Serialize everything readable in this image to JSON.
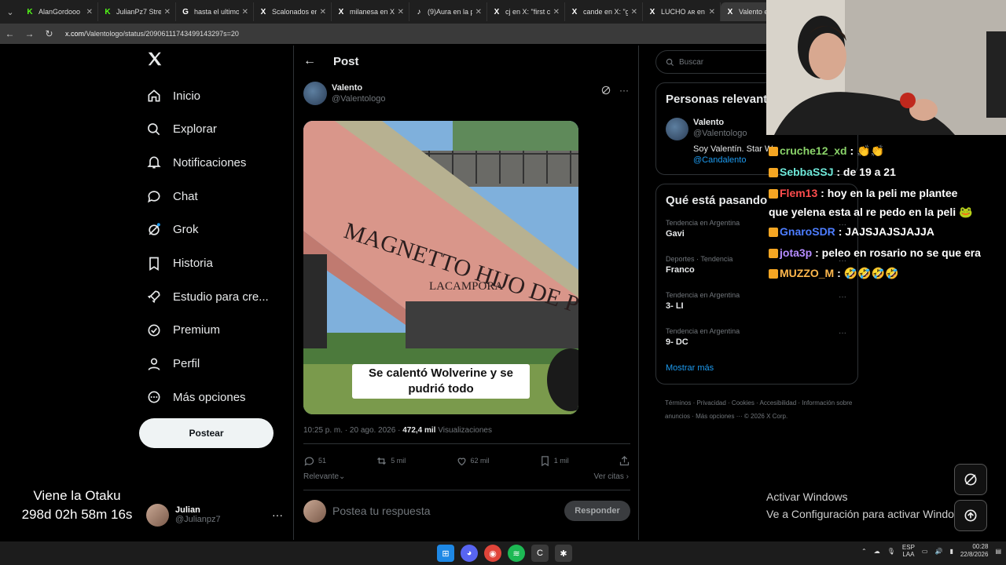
{
  "browser": {
    "tabs": [
      {
        "title": "AlanGordooo",
        "fav": "K",
        "color": "#53fc18"
      },
      {
        "title": "JulianPz7 Stre",
        "fav": "K",
        "color": "#53fc18"
      },
      {
        "title": "hasta el ultimo",
        "fav": "G",
        "color": "#ffffff"
      },
      {
        "title": "Scalonados en",
        "fav": "X",
        "color": "#ffffff"
      },
      {
        "title": "milanesa en X:",
        "fav": "X",
        "color": "#ffffff"
      },
      {
        "title": "(9)Aura en la p",
        "fav": "♪",
        "color": "#ffffff"
      },
      {
        "title": "cj en X: \"first c",
        "fav": "X",
        "color": "#ffffff"
      },
      {
        "title": "cande en X: \"g",
        "fav": "X",
        "color": "#ffffff"
      },
      {
        "title": "LUCHO ᴀʀ en",
        "fav": "X",
        "color": "#ffffff"
      },
      {
        "title": "Valento en",
        "fav": "X",
        "color": "#ffffff"
      }
    ],
    "url_host": "x.com",
    "url_path": "/Valentologo/status/20906111743499143297s=20"
  },
  "nav": {
    "items": [
      {
        "label": "Inicio",
        "icon": "home-icon"
      },
      {
        "label": "Explorar",
        "icon": "search-icon"
      },
      {
        "label": "Notificaciones",
        "icon": "bell-icon"
      },
      {
        "label": "Chat",
        "icon": "chat-icon"
      },
      {
        "label": "Grok",
        "icon": "grok-icon"
      },
      {
        "label": "Historia",
        "icon": "bookmark-icon"
      },
      {
        "label": "Estudio para cre...",
        "icon": "rocket-icon"
      },
      {
        "label": "Premium",
        "icon": "verified-icon"
      },
      {
        "label": "Perfil",
        "icon": "person-icon"
      },
      {
        "label": "Más opciones",
        "icon": "more-circle-icon"
      }
    ],
    "post_button": "Postear",
    "account": {
      "name": "Julian",
      "handle": "@Julianpz7"
    }
  },
  "overlay_timer": {
    "line1": "Viene la Otaku",
    "line2": "298d 02h 58m 16s"
  },
  "post": {
    "header": "Post",
    "author_name": "Valento",
    "author_handle": "@Valentologo",
    "image_graffiti": "MAGNETTO HIJO DE PUTA",
    "image_graffiti_sub": "LACAMPORA",
    "caption": "Se calentó Wolverine y se pudrió todo",
    "timestamp": "10:25 p. m. · 20 ago. 2026 · ",
    "views_count": "472,4 mil",
    "views_label": " Visualizaciones",
    "replies": "51",
    "reposts": "5 mil",
    "likes": "62 mil",
    "bookmarks": "1 mil",
    "sort_label": "Relevante",
    "quotes_label": "Ver citas",
    "reply_placeholder": "Postea tu respuesta",
    "reply_button": "Responder"
  },
  "right": {
    "search_placeholder": "Buscar",
    "relevant_title": "Personas relevantes",
    "relevant_user": {
      "name": "Valento",
      "handle": "@Valentologo",
      "bio": "Soy Valentín. Star W",
      "link": "@Candalento"
    },
    "trends_title": "Qué está pasando",
    "trends": [
      {
        "context": "Tendencia en Argentina",
        "name": "Gavi"
      },
      {
        "context": "Deportes · Tendencia",
        "name": "Franco"
      },
      {
        "context": "Tendencia en Argentina",
        "name": "3- LI"
      },
      {
        "context": "Tendencia en Argentina",
        "name": "9- DC"
      }
    ],
    "show_more": "Mostrar más",
    "footer": "Términos · Privacidad · Cookies · Accesibilidad · Información sobre anuncios · Más opciones ··· © 2026 X Corp."
  },
  "chat": [
    {
      "user": "cruche12_xd",
      "text": ": 👏👏",
      "color": "#8bd46a"
    },
    {
      "user": "SebbaSSJ",
      "text": ": de 19 a 21",
      "color": "#6ee8d9"
    },
    {
      "user": "Flem13",
      "text": ":  hoy en la peli me plantee",
      "color": "#ff4d4d"
    },
    {
      "user": "",
      "text": "que yelena esta al re pedo en la peli 🐸",
      "color": "#ffffff"
    },
    {
      "user": "GnaroSDR",
      "text": ": JAJSJAJSJAJJA",
      "color": "#4d7dff"
    },
    {
      "user": "jota3p",
      "text": ": peleo en rosario no se que era",
      "color": "#b58cff"
    },
    {
      "user": "MUZZO_M",
      "text": ": 🤣🤣🤣🤣",
      "color": "#ffb84d"
    }
  ],
  "windows": {
    "activate_title": "Activar Windows",
    "activate_sub": "Ve a Configuración para activar Windows",
    "lang": "ESP",
    "lang2": "LAA",
    "time": "00:28",
    "date": "22/8/2026"
  }
}
